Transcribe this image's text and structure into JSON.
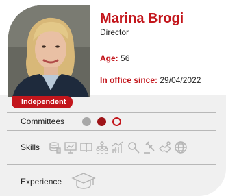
{
  "profile": {
    "name": "Marina Brogi",
    "role": "Director",
    "age_label": "Age:",
    "age_value": "56",
    "office_label": "In office since:",
    "office_value": "29/04/2022",
    "badge": "Independent"
  },
  "sections": {
    "committees_label": "Committees",
    "skills_label": "Skills",
    "experience_label": "Experience"
  },
  "committee_dots": [
    {
      "state": "inactive",
      "color": "#a8a8a8"
    },
    {
      "state": "chair",
      "color": "#9e1418"
    },
    {
      "state": "member",
      "color": "#c3161c"
    }
  ],
  "skill_icons": [
    "finance-icon",
    "presentation-icon",
    "book-icon",
    "organization-icon",
    "growth-chart-icon",
    "magnifier-icon",
    "gavel-icon",
    "handshake-icon",
    "globe-icon"
  ],
  "experience_icons": [
    "graduation-cap-icon"
  ],
  "colors": {
    "accent": "#c3161c",
    "panel": "#f0f0f0",
    "text": "#222222"
  }
}
